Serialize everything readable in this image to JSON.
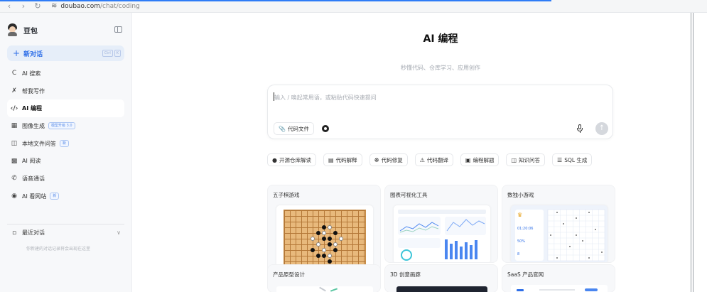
{
  "browser": {
    "url_host": "doubao.com",
    "url_path": "/chat/coding",
    "progress_percent": 78
  },
  "sidebar": {
    "brand": "豆包",
    "new_chat": "新对话",
    "new_chat_shortcut": [
      "Ctrl",
      "K"
    ],
    "items": [
      {
        "label": "AI 搜索",
        "icon": "search-icon"
      },
      {
        "label": "帮我写作",
        "icon": "pen-icon"
      },
      {
        "label": "AI 编程",
        "icon": "code-icon",
        "active": true
      },
      {
        "label": "图像生成",
        "icon": "image-icon",
        "badge": "模型升级 3.0"
      },
      {
        "label": "本地文件问答",
        "icon": "file-icon",
        "badge": "新"
      },
      {
        "label": "AI 阅读",
        "icon": "book-icon"
      },
      {
        "label": "语音通话",
        "icon": "phone-icon"
      },
      {
        "label": "AI 看网站",
        "icon": "globe-icon",
        "badge": "新"
      }
    ],
    "recent_label": "最近对话",
    "recent_hint": "你新建的对话记录将会出现在这里"
  },
  "main": {
    "title": "AI 编程",
    "subtitle": "秒懂代码、仓库学习、应用创作",
    "input_placeholder": "输入 / 唤起常用语，或粘贴代码快速提问",
    "code_file_label": "代码文件",
    "chips": [
      {
        "label": "开源仓库解读",
        "icon": "github-icon"
      },
      {
        "label": "代码解释",
        "icon": "comment-code-icon"
      },
      {
        "label": "代码修复",
        "icon": "bug-icon"
      },
      {
        "label": "代码翻译",
        "icon": "translate-icon"
      },
      {
        "label": "编程解题",
        "icon": "window-icon"
      },
      {
        "label": "知识问答",
        "icon": "notebook-icon"
      },
      {
        "label": "SQL 生成",
        "icon": "database-icon"
      }
    ],
    "cards": [
      {
        "title": "五子棋游戏"
      },
      {
        "title": "图表可视化工具"
      },
      {
        "title": "数独小游戏"
      },
      {
        "title": "产品原型设计"
      },
      {
        "title": "3D 创意画廊"
      },
      {
        "title": "SaaS 产品官网"
      }
    ],
    "sudoku_thumb": {
      "stat1": "01:20:06",
      "stat2": "50%",
      "stat3": "8"
    },
    "colors": {
      "accent": "#2f6fe8",
      "sidebar_bg": "#f7f8fa",
      "card_bg": "#f7f8fa"
    }
  }
}
